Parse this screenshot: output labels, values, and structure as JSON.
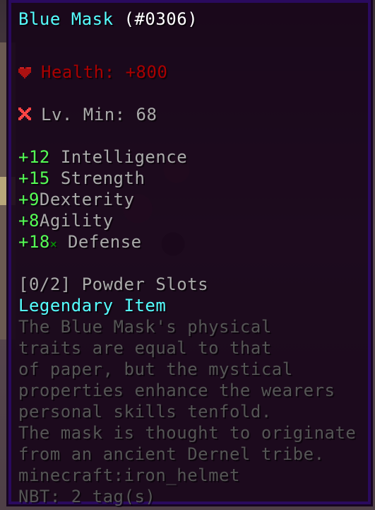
{
  "item": {
    "name": "Blue Mask",
    "id": "(#0306)",
    "health": "Health: +800",
    "level_min": "Lv. Min: 68",
    "stats": [
      {
        "value": "+12",
        "name": "Intelligence"
      },
      {
        "value": "+15",
        "name": "Strength"
      },
      {
        "value": "+9",
        "name": "Dexterity"
      },
      {
        "value": "+8",
        "name": "Agility"
      },
      {
        "value": "+18",
        "name": "Defense",
        "mark": "✕"
      }
    ],
    "powder_slots": "[0/2] Powder Slots",
    "rarity": "Legendary Item",
    "lore": [
      "The Blue Mask's physical",
      "traits are equal to that",
      "of paper, but the mystical",
      "properties enhance the wearers",
      "personal skills tenfold.",
      "The mask is thought to originate",
      "from an ancient Dernel tribe."
    ],
    "minecraft_id": "minecraft:iron_helmet",
    "nbt": "NBT: 2 tag(s)"
  },
  "colors": {
    "name": "#55ffff",
    "health": "#aa0000",
    "stat_value": "#55ff55",
    "stat_name": "#aaaaaa",
    "rarity": "#55ffff",
    "lore": "#555555"
  },
  "icons": {
    "health": "heart-icon",
    "level_fail": "red-cross-icon"
  }
}
